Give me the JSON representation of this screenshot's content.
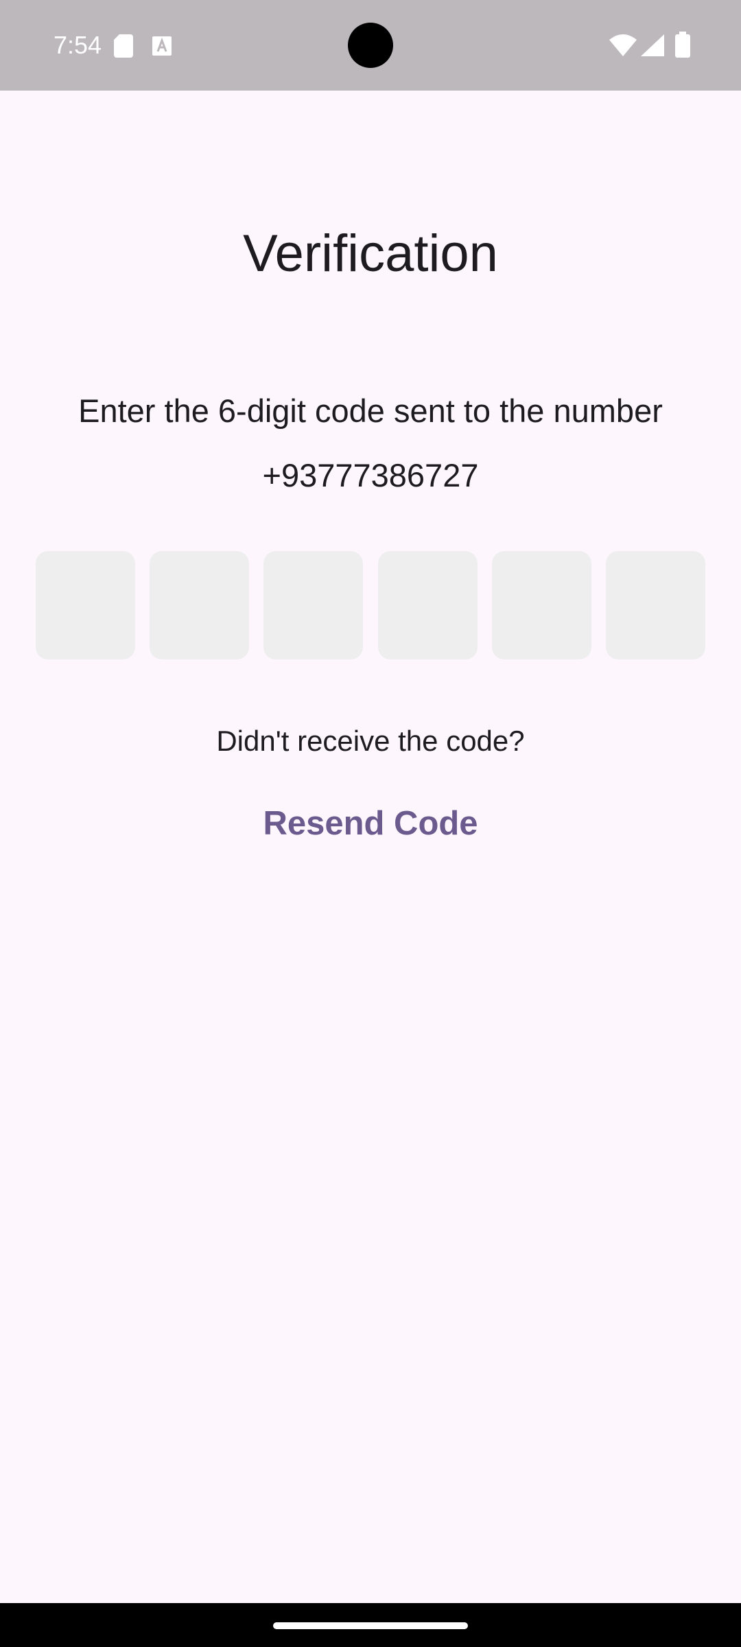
{
  "status_bar": {
    "time": "7:54",
    "icons": [
      "sd-card-icon",
      "text-a-icon",
      "wifi-icon",
      "signal-icon",
      "battery-icon"
    ]
  },
  "verification": {
    "title": "Verification",
    "instruction_line1": "Enter the 6-digit code sent to the number",
    "phone_number": "+93777386727",
    "code_digits": [
      "",
      "",
      "",
      "",
      "",
      ""
    ],
    "didnt_receive": "Didn't receive the code?",
    "resend_label": "Resend Code"
  },
  "colors": {
    "background": "#fdf7fd",
    "status_bar": "#bdb8bc",
    "code_box": "#eeeeee",
    "accent": "#6a5a8e",
    "text": "#1d1b20"
  }
}
